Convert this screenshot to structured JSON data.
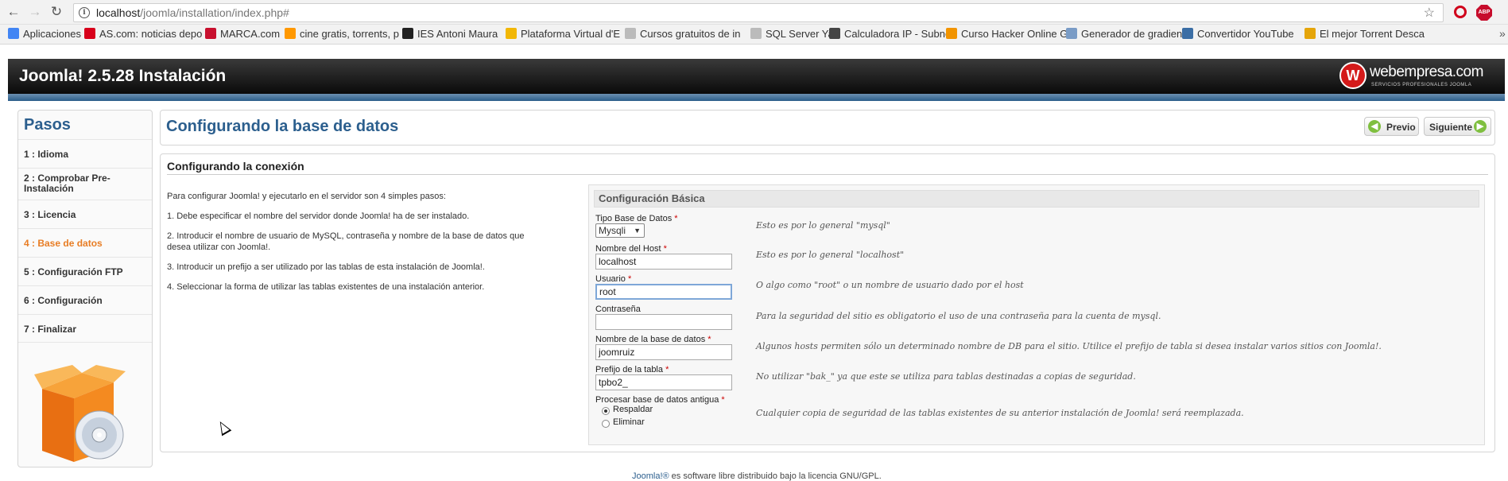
{
  "browser": {
    "url_host": "localhost",
    "url_path": "/joomla/installation/index.php#",
    "bookmarks": [
      {
        "label": "Aplicaciones",
        "color": "#4285f4"
      },
      {
        "label": "AS.com: noticias depo",
        "color": "#d8001b"
      },
      {
        "label": "MARCA.com",
        "color": "#c8102e"
      },
      {
        "label": "cine gratis, torrents, p",
        "color": "#ff9800"
      },
      {
        "label": "IES Antoni Maura",
        "color": "#222222"
      },
      {
        "label": "Plataforma Virtual d'E",
        "color": "#f2b705"
      },
      {
        "label": "Cursos gratuitos de in",
        "color": "#bbbbbb"
      },
      {
        "label": "SQL Server Ya",
        "color": "#bbbbbb"
      },
      {
        "label": "Calculadora IP - Subne",
        "color": "#444444"
      },
      {
        "label": "Curso Hacker Online G",
        "color": "#f29400"
      },
      {
        "label": "Generador de gradien",
        "color": "#7a9cc6"
      },
      {
        "label": "Convertidor YouTube",
        "color": "#3b6ea5"
      },
      {
        "label": "El mejor Torrent Desca",
        "color": "#e5a50a"
      }
    ]
  },
  "header": {
    "title": "Joomla! 2.5.28 Instalación",
    "logo_name": "webempresa.com",
    "logo_tagline": "SERVICIOS PROFESIONALES JOOMLA",
    "logo_letter": "W"
  },
  "sidebar": {
    "title": "Pasos",
    "active_color": "#e87d24",
    "steps": [
      {
        "label": "1 : Idioma"
      },
      {
        "label": "2 : Comprobar Pre-Instalación"
      },
      {
        "label": "3 : Licencia"
      },
      {
        "label": "4 : Base de datos",
        "active": true
      },
      {
        "label": "5 : Configuración FTP"
      },
      {
        "label": "6 : Configuración"
      },
      {
        "label": "7 : Finalizar"
      }
    ]
  },
  "main": {
    "page_title": "Configurando la base de datos",
    "prev_label": "Previo",
    "next_label": "Siguiente",
    "section_title": "Configurando la conexión",
    "instructions": [
      "Para configurar Joomla! y ejecutarlo en el servidor son 4 simples pasos:",
      "1. Debe especificar el nombre del servidor donde Joomla! ha de ser instalado.",
      "2. Introducir el nombre de usuario de MySQL, contraseña y nombre de la base de datos que desea utilizar con Joomla!.",
      "3. Introducir un prefijo a ser utilizado por las tablas de esta instalación de Joomla!.",
      "4. Seleccionar la forma de utilizar las tablas existentes de una instalación anterior."
    ],
    "config": {
      "header": "Configuración Básica",
      "db_type": {
        "label": "Tipo Base de Datos",
        "value": "Mysqli",
        "hint": "Esto es por lo general \"mysql\""
      },
      "host": {
        "label": "Nombre del Host",
        "value": "localhost",
        "hint": "Esto es por lo general \"localhost\""
      },
      "user": {
        "label": "Usuario",
        "value": "root",
        "hint": "O algo como \"root\" o un nombre de usuario dado por el host"
      },
      "password": {
        "label": "Contraseña",
        "value": "",
        "hint": "Para la seguridad del sitio es obligatorio el uso de una contraseña para la cuenta de mysql."
      },
      "db_name": {
        "label": "Nombre de la base de datos",
        "value": "joomruiz",
        "hint": "Algunos hosts permiten sólo un determinado nombre de DB para el sitio. Utilice el prefijo de tabla si desea instalar varios sitios con Joomla!."
      },
      "prefix": {
        "label": "Prefijo de la tabla",
        "value": "tpbo2_",
        "hint": "No utilizar \"bak_\" ya que este se utiliza para tablas destinadas a copias de seguridad."
      },
      "old_db": {
        "label": "Procesar base de datos antigua",
        "option_backup": "Respaldar",
        "option_delete": "Eliminar",
        "selected": "Respaldar",
        "hint": "Cualquier copia de seguridad de las tablas existentes de su anterior instalación de Joomla! será reemplazada."
      }
    }
  },
  "footer": {
    "link": "Joomla!®",
    "text": " es software libre distribuido bajo la licencia GNU/GPL."
  }
}
